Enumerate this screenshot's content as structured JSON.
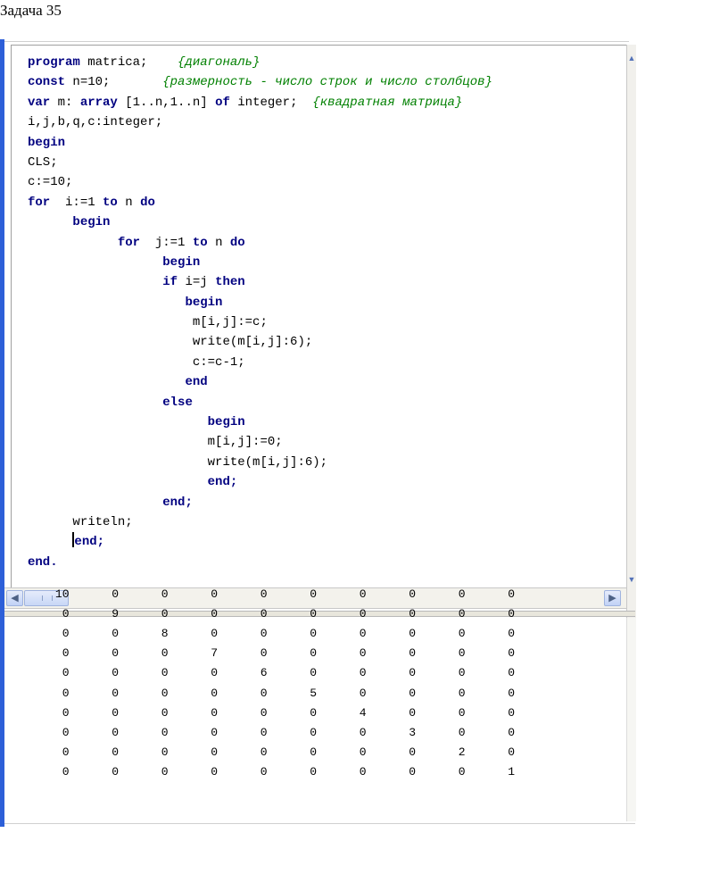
{
  "heading": "Задача 35",
  "editor": {
    "lines": [
      {
        "indent": "",
        "tokens": [
          [
            "kw",
            "program"
          ],
          [
            "id",
            " matrica;    "
          ],
          [
            "cmt",
            "{диагональ}"
          ]
        ]
      },
      {
        "indent": "",
        "tokens": [
          [
            "kw",
            "const"
          ],
          [
            "id",
            " n=10;       "
          ],
          [
            "cmt",
            "{размерность - число строк и число столбцов}"
          ]
        ]
      },
      {
        "indent": "",
        "tokens": [
          [
            "kw",
            "var"
          ],
          [
            "id",
            " m: "
          ],
          [
            "kw",
            "array"
          ],
          [
            "id",
            " [1..n,1..n] "
          ],
          [
            "kw",
            "of"
          ],
          [
            "id",
            " integer;  "
          ],
          [
            "cmt",
            "{квадратная матрица}"
          ]
        ]
      },
      {
        "indent": "",
        "tokens": [
          [
            "id",
            "i,j,b,q,c:integer;"
          ]
        ]
      },
      {
        "indent": "",
        "tokens": [
          [
            "kw",
            "begin"
          ]
        ]
      },
      {
        "indent": "",
        "tokens": [
          [
            "id",
            "CLS;"
          ]
        ]
      },
      {
        "indent": "",
        "tokens": [
          [
            "id",
            "c:=10;"
          ]
        ]
      },
      {
        "indent": "",
        "tokens": [
          [
            "kw",
            "for"
          ],
          [
            "id",
            "  i:=1 "
          ],
          [
            "kw",
            "to"
          ],
          [
            "id",
            " n "
          ],
          [
            "kw",
            "do"
          ]
        ]
      },
      {
        "indent": "      ",
        "tokens": [
          [
            "kw",
            "begin"
          ]
        ]
      },
      {
        "indent": "            ",
        "tokens": [
          [
            "kw",
            "for"
          ],
          [
            "id",
            "  j:=1 "
          ],
          [
            "kw",
            "to"
          ],
          [
            "id",
            " n "
          ],
          [
            "kw",
            "do"
          ]
        ]
      },
      {
        "indent": "                  ",
        "tokens": [
          [
            "kw",
            "begin"
          ]
        ]
      },
      {
        "indent": "                  ",
        "tokens": [
          [
            "kw",
            "if"
          ],
          [
            "id",
            " i=j "
          ],
          [
            "kw",
            "then"
          ]
        ]
      },
      {
        "indent": "                     ",
        "tokens": [
          [
            "kw",
            "begin"
          ]
        ]
      },
      {
        "indent": "                      ",
        "tokens": [
          [
            "id",
            "m[i,j]:=c;"
          ]
        ]
      },
      {
        "indent": "                      ",
        "tokens": [
          [
            "id",
            "write(m[i,j]:6);"
          ]
        ]
      },
      {
        "indent": "                      ",
        "tokens": [
          [
            "id",
            "c:=c-1;"
          ]
        ]
      },
      {
        "indent": "                     ",
        "tokens": [
          [
            "kw",
            "end"
          ]
        ]
      },
      {
        "indent": "                  ",
        "tokens": [
          [
            "kw",
            "else"
          ]
        ]
      },
      {
        "indent": "                        ",
        "tokens": [
          [
            "kw",
            "begin"
          ]
        ]
      },
      {
        "indent": "                        ",
        "tokens": [
          [
            "id",
            "m[i,j]:=0;"
          ]
        ]
      },
      {
        "indent": "                        ",
        "tokens": [
          [
            "id",
            "write(m[i,j]:6);"
          ]
        ]
      },
      {
        "indent": "                        ",
        "tokens": [
          [
            "kw",
            "end;"
          ]
        ]
      },
      {
        "indent": "                  ",
        "tokens": [
          [
            "kw",
            "end;"
          ]
        ]
      },
      {
        "indent": "      ",
        "tokens": [
          [
            "id",
            "writeln;"
          ]
        ]
      },
      {
        "indent": "      ",
        "caret": true,
        "tokens": [
          [
            "kw",
            "end;"
          ]
        ]
      },
      {
        "indent": "",
        "tokens": [
          [
            "kw",
            "end."
          ]
        ]
      }
    ]
  },
  "output": {
    "rows": [
      [
        "10",
        "0",
        "0",
        "0",
        "0",
        "0",
        "0",
        "0",
        "0",
        "0"
      ],
      [
        "0",
        "9",
        "0",
        "0",
        "0",
        "0",
        "0",
        "0",
        "0",
        "0"
      ],
      [
        "0",
        "0",
        "8",
        "0",
        "0",
        "0",
        "0",
        "0",
        "0",
        "0"
      ],
      [
        "0",
        "0",
        "0",
        "7",
        "0",
        "0",
        "0",
        "0",
        "0",
        "0"
      ],
      [
        "0",
        "0",
        "0",
        "0",
        "6",
        "0",
        "0",
        "0",
        "0",
        "0"
      ],
      [
        "0",
        "0",
        "0",
        "0",
        "0",
        "5",
        "0",
        "0",
        "0",
        "0"
      ],
      [
        "0",
        "0",
        "0",
        "0",
        "0",
        "0",
        "4",
        "0",
        "0",
        "0"
      ],
      [
        "0",
        "0",
        "0",
        "0",
        "0",
        "0",
        "0",
        "3",
        "0",
        "0"
      ],
      [
        "0",
        "0",
        "0",
        "0",
        "0",
        "0",
        "0",
        "0",
        "2",
        "0"
      ],
      [
        "0",
        "0",
        "0",
        "0",
        "0",
        "0",
        "0",
        "0",
        "0",
        "1"
      ]
    ]
  },
  "icons": {
    "scroll_left": "◀",
    "scroll_right": "▶",
    "scroll_up": "▲",
    "scroll_down": "▼"
  },
  "colors": {
    "keyword": "#000080",
    "comment": "#008000",
    "window_accent": "#2d5fd8"
  }
}
